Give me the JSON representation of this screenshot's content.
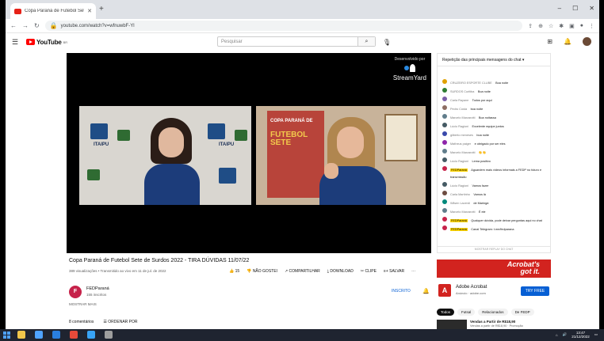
{
  "browser": {
    "tab_title": "Copa Paraná de Futebol Sete ·",
    "new_tab": "+",
    "url": "youtube.com/watch?v=wfnuwbF-Yl",
    "window_controls": [
      "–",
      "☐",
      "✕"
    ]
  },
  "youtube": {
    "logo_text": "YouTube",
    "country_code": "BR",
    "search_placeholder": "Pesquisar"
  },
  "video": {
    "brand_caption": "Desenvolvido por",
    "brand_name": "StreamYard",
    "left_cam_label": "ITAIPU",
    "right_cam_banner_top": "COPA PARANÁ DE",
    "right_cam_banner_big": "FUTEBOL SETE",
    "title": "Copa Paraná de Futebol Sete de Surdos 2022 - TIRA DÚVIDAS 11/07/22",
    "meta": "389 visualizações • Transmitido ao vivo em 11 de jul. de 2022",
    "actions": {
      "like": "15",
      "dislike": "NÃO GOSTEI",
      "share": "COMPARTILHAR",
      "download": "DOWNLOAD",
      "clip": "CLIPE",
      "save": "SALVAR",
      "more": "···"
    }
  },
  "channel": {
    "avatar_letter": "F",
    "name": "FEDParaná",
    "subscribers": "155 inscritos",
    "join": "INSCRITO",
    "show_more": "MOSTRAR MAIS"
  },
  "comments": {
    "count": "8 comentários",
    "sort": "ORDENAR POR"
  },
  "chat": {
    "header": "Repetição das principais mensagens do chat ▾",
    "messages": [
      {
        "author": "CRUZEIRO ESPORTE CLUBE",
        "text": "Boa noite",
        "highlight": false,
        "color": "#e0a000"
      },
      {
        "author": "SURDOS Curitiba",
        "text": "Boa noite",
        "highlight": false,
        "color": "#2e7d32"
      },
      {
        "author": "Carla Rayane",
        "text": "Todos por aqui",
        "highlight": false,
        "color": "#7b5ea7"
      },
      {
        "author": "Pedro Costa",
        "text": "boa noite",
        "highlight": false,
        "color": "#8d6e63"
      },
      {
        "author": "Marcelo Marzarotti",
        "text": "Boa noitassa",
        "highlight": false,
        "color": "#607d8b"
      },
      {
        "author": "Lúcio Ragioni",
        "text": "Excelente equipe juntos",
        "highlight": false,
        "color": "#455a64"
      },
      {
        "author": "gilberto meneses",
        "text": "boa noite",
        "highlight": false,
        "color": "#3949ab"
      },
      {
        "author": "Matheus paiger",
        "text": "e obrigado por ser eles",
        "highlight": false,
        "color": "#8e24aa"
      },
      {
        "author": "Marcelo Marzarotti",
        "text": "👏👏",
        "highlight": false,
        "color": "#607d8b"
      },
      {
        "author": "Lúcio Ragioni",
        "text": "Lema positivo",
        "highlight": false,
        "color": "#455a64"
      },
      {
        "author": "FEDParaná",
        "text": "Aguardem mais vídeos informais a FEDP no futuro e transmissão",
        "highlight": true,
        "color": "#c6224a"
      },
      {
        "author": "Lúcio Ragioni",
        "text": "Vamos fazer",
        "highlight": false,
        "color": "#455a64"
      },
      {
        "author": "Carla Martinho",
        "text": "Vamos lá",
        "highlight": false,
        "color": "#6d4c41"
      },
      {
        "author": "Wilsen Lacerdi",
        "text": "de Maringá",
        "highlight": false,
        "color": "#00897b"
      },
      {
        "author": "Marcelo Marzarotti",
        "text": "É ele",
        "highlight": false,
        "color": "#607d8b"
      },
      {
        "author": "FEDParaná",
        "text": "Qualquer dúvida, pode deixar perguntas aqui no chat",
        "highlight": true,
        "color": "#c6224a"
      },
      {
        "author": "FEDParaná",
        "text": "Canal Telegram: t.me/fedparana",
        "highlight": true,
        "color": "#c6224a"
      }
    ],
    "footer": "MOSTRAR REPLAY DO CHAT"
  },
  "ad": {
    "banner_line1": "Acrobat's",
    "banner_line2": "got it.",
    "icon": "A",
    "title": "Adobe Acrobat",
    "subtitle": "Anúncio · adobe.com",
    "button": "TRY FREE"
  },
  "related": {
    "chips": [
      "Todos",
      "Futsal",
      "Relacionados",
      "De FEDP"
    ],
    "first_title": "Vendas a Partir de R$18,90",
    "first_sub": "Vendas a partir de R$18,90 · Promoção"
  },
  "taskbar": {
    "time": "13:47",
    "date": "21/12/2022",
    "icon_colors": [
      "#f0c64b",
      "#4fa3ff",
      "#2a7fe0",
      "#e84a3a",
      "#38a3f5",
      "#9e9e9e"
    ]
  }
}
